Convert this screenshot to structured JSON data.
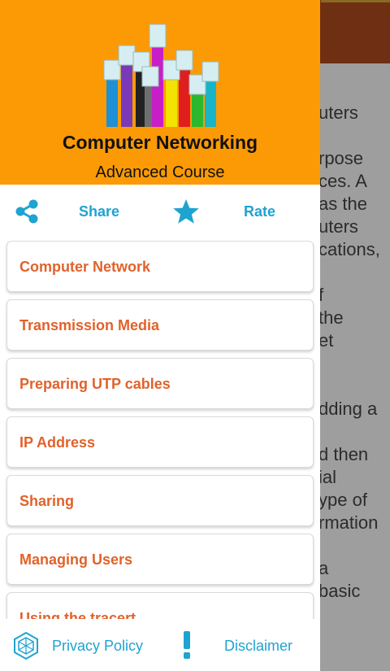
{
  "app": {
    "title": "Computer Networking",
    "subtitle": "Advanced Course"
  },
  "actions": {
    "share_label": "Share",
    "rate_label": "Rate"
  },
  "menu": {
    "items": [
      {
        "label": "Computer Network"
      },
      {
        "label": "Transmission Media"
      },
      {
        "label": "Preparing UTP cables"
      },
      {
        "label": "IP Address"
      },
      {
        "label": "Sharing"
      },
      {
        "label": "Managing Users"
      },
      {
        "label": "Using the tracert"
      }
    ]
  },
  "footer": {
    "privacy_label": "Privacy Policy",
    "disclaimer_label": "Disclaimer"
  },
  "background_text": {
    "lines": [
      "uters",
      "rpose",
      "ces. A",
      "as the",
      "uters",
      "cations,",
      "f",
      "the",
      "et",
      "dding a",
      "d then",
      "ial",
      "ype of",
      "rmation",
      "a",
      "basic"
    ]
  },
  "colors": {
    "header": "#fb9a04",
    "accent_blue": "#1fa3d1",
    "menu_text": "#e1622b",
    "scrim": "#9e9e9e"
  },
  "icons": [
    "share-icon",
    "star-icon",
    "privacy-icon",
    "exclamation-icon",
    "ethernet-cables-logo"
  ]
}
